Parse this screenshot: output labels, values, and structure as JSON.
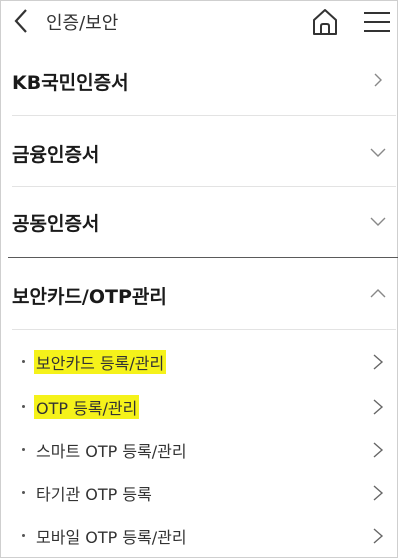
{
  "header": {
    "title": "인증/보안",
    "back_icon": "chevron-left-icon",
    "home_icon": "home-icon",
    "menu_icon": "hamburger-menu-icon"
  },
  "sections": [
    {
      "label": "KB국민인증서",
      "chevron": "chevron-right-icon"
    },
    {
      "label": "금융인증서",
      "chevron": "chevron-down-icon"
    },
    {
      "label": "공동인증서",
      "chevron": "chevron-down-icon"
    },
    {
      "label": "보안카드/OTP관리",
      "chevron": "chevron-up-icon",
      "expanded": true
    }
  ],
  "sub_items": [
    {
      "label": "보안카드 등록/관리",
      "highlighted": true
    },
    {
      "label": "OTP 등록/관리",
      "highlighted": true
    },
    {
      "label": "스마트 OTP 등록/관리",
      "highlighted": false
    },
    {
      "label": "타기관 OTP 등록",
      "highlighted": false
    },
    {
      "label": "모바일 OTP 등록/관리",
      "highlighted": false
    }
  ],
  "colors": {
    "highlight": "#f5f21a",
    "divider": "#e3e3e3",
    "divider_dark": "#5a5a5a"
  }
}
